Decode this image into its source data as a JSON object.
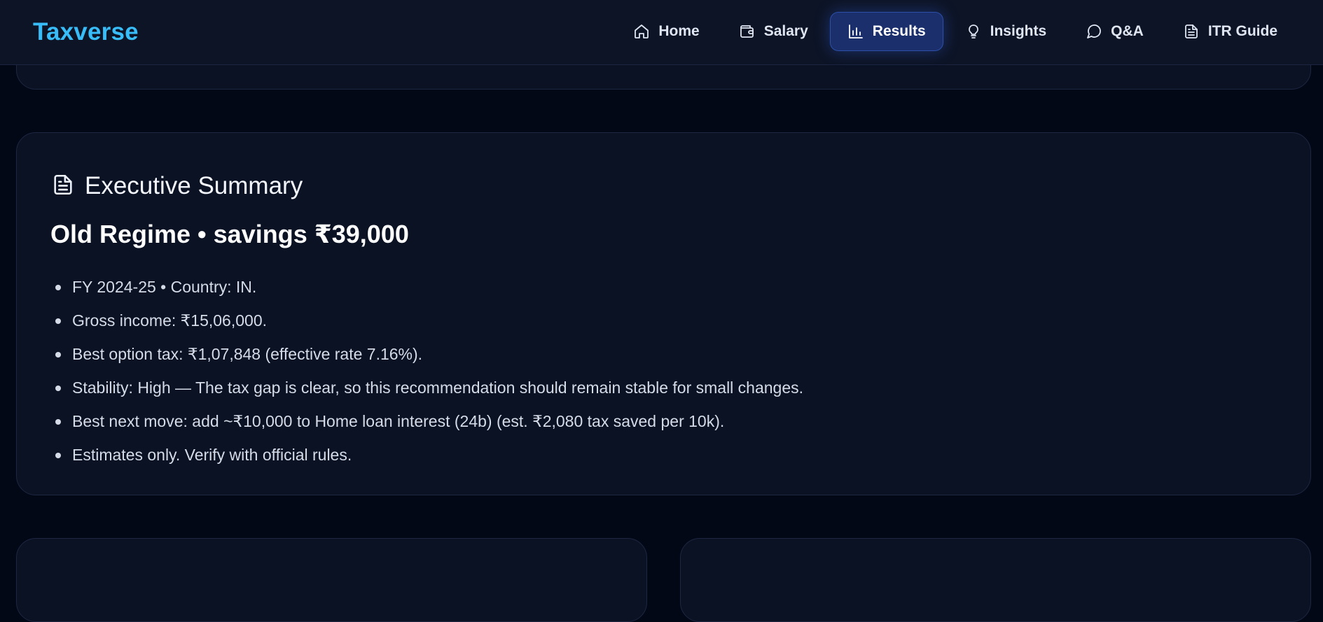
{
  "brand": "Taxverse",
  "nav": {
    "items": [
      {
        "label": "Home",
        "icon": "home-icon",
        "active": false
      },
      {
        "label": "Salary",
        "icon": "wallet-icon",
        "active": false
      },
      {
        "label": "Results",
        "icon": "bar-chart-icon",
        "active": true
      },
      {
        "label": "Insights",
        "icon": "lightbulb-icon",
        "active": false
      },
      {
        "label": "Q&A",
        "icon": "chat-bubble-icon",
        "active": false
      },
      {
        "label": "ITR Guide",
        "icon": "document-icon",
        "active": false
      }
    ]
  },
  "summary": {
    "title": "Executive Summary",
    "icon": "document-icon",
    "headline": "Old Regime • savings ₹39,000",
    "bullets": [
      "FY 2024-25 • Country: IN.",
      "Gross income: ₹15,06,000.",
      "Best option tax: ₹1,07,848 (effective rate 7.16%).",
      "Stability: High — The tax gap is clear, so this recommendation should remain stable for small changes.",
      "Best next move: add ~₹10,000 to Home loan interest (24b) (est. ₹2,080 tax saved per 10k).",
      "Estimates only. Verify with official rules."
    ]
  },
  "colors": {
    "background": "#030817",
    "card": "#0b1224",
    "brand": "#38bdf8",
    "active_nav": "#1a2f6b"
  }
}
